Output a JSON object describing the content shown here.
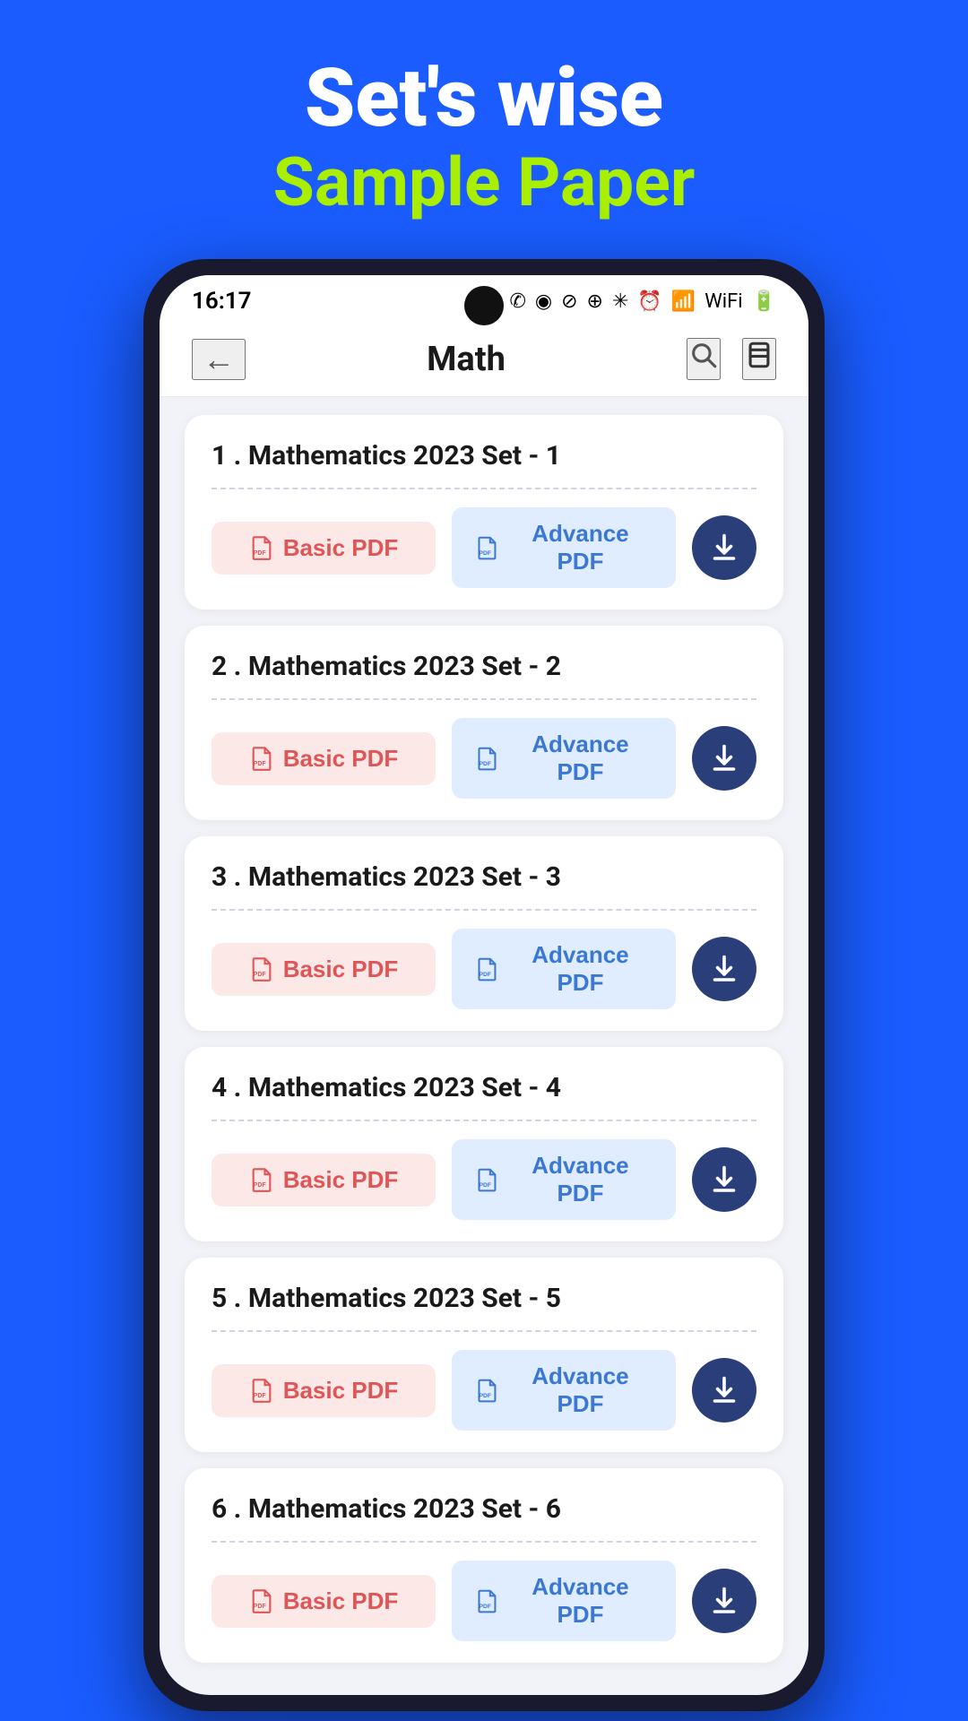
{
  "header": {
    "title": "Set's wise",
    "subtitle": "Sample Paper"
  },
  "status_bar": {
    "time": "16:17",
    "icons": [
      "whatsapp",
      "media",
      "dnd",
      "location",
      "bluetooth",
      "alarm",
      "signal",
      "wifi",
      "battery"
    ]
  },
  "nav": {
    "title": "Math",
    "back_label": "←",
    "search_label": "🔍",
    "bookmark_label": "🔖"
  },
  "papers": [
    {
      "id": 1,
      "title": "1 . Mathematics 2023 Set - 1",
      "basic_pdf": "Basic PDF",
      "advance_pdf": "Advance PDF"
    },
    {
      "id": 2,
      "title": "2 . Mathematics 2023 Set - 2",
      "basic_pdf": "Basic PDF",
      "advance_pdf": "Advance PDF"
    },
    {
      "id": 3,
      "title": "3 . Mathematics 2023 Set - 3",
      "basic_pdf": "Basic PDF",
      "advance_pdf": "Advance PDF"
    },
    {
      "id": 4,
      "title": "4 . Mathematics 2023 Set - 4",
      "basic_pdf": "Basic PDF",
      "advance_pdf": "Advance PDF"
    },
    {
      "id": 5,
      "title": "5 . Mathematics 2023 Set - 5",
      "basic_pdf": "Basic PDF",
      "advance_pdf": "Advance PDF"
    },
    {
      "id": 6,
      "title": "6 . Mathematics 2023 Set - 6",
      "basic_pdf": "Basic PDF",
      "advance_pdf": "Advance PDF"
    }
  ],
  "colors": {
    "background": "#1a5cff",
    "header_title": "#ffffff",
    "header_subtitle": "#aaee00",
    "nav_bg": "#ffffff",
    "card_bg": "#ffffff",
    "download_btn": "#2a3f7a",
    "basic_pdf_bg": "#fde8e8",
    "basic_pdf_text": "#e05555",
    "advance_pdf_bg": "#e0ecff",
    "advance_pdf_text": "#3a78d4"
  }
}
